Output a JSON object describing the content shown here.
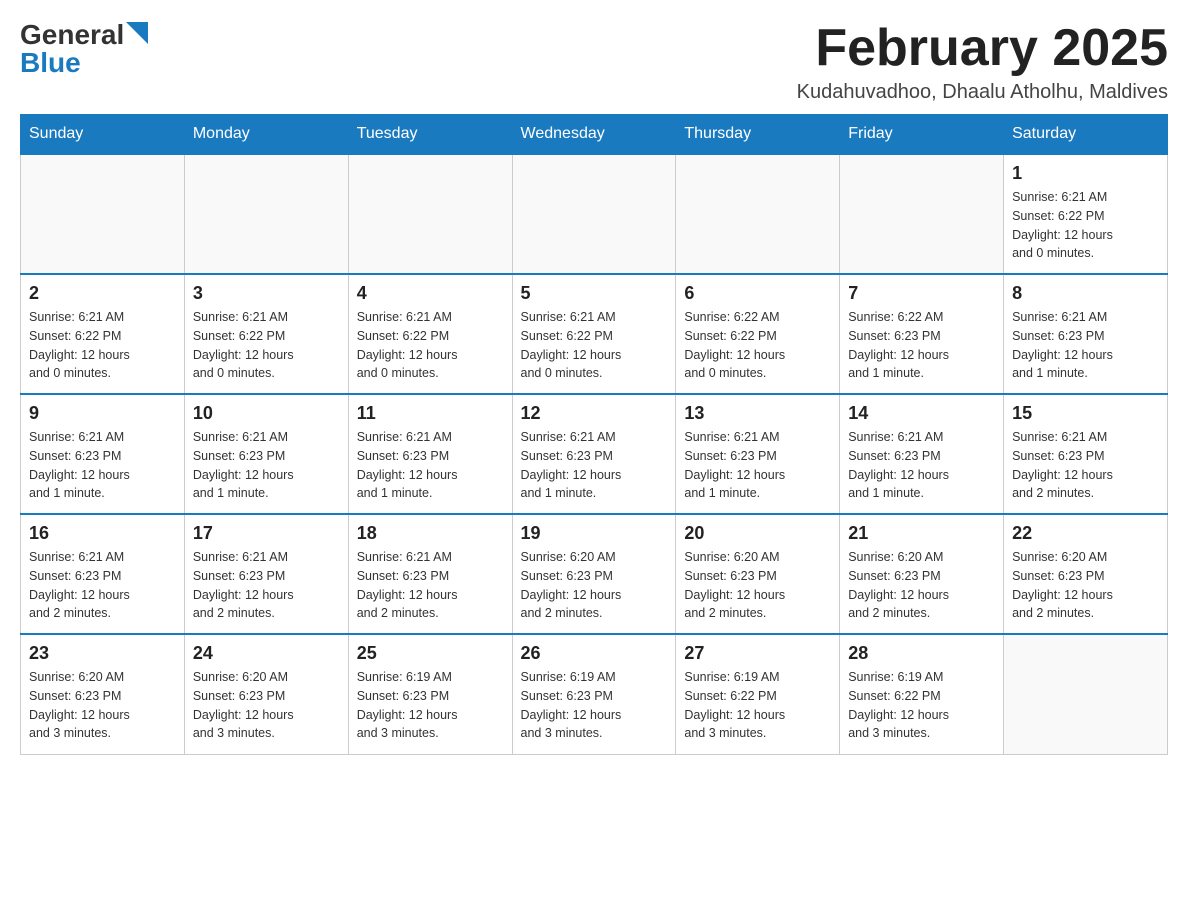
{
  "header": {
    "logo_general": "General",
    "logo_blue": "Blue",
    "month_title": "February 2025",
    "location": "Kudahuvadhoo, Dhaalu Atholhu, Maldives"
  },
  "weekdays": [
    "Sunday",
    "Monday",
    "Tuesday",
    "Wednesday",
    "Thursday",
    "Friday",
    "Saturday"
  ],
  "weeks": [
    [
      {
        "day": "",
        "info": ""
      },
      {
        "day": "",
        "info": ""
      },
      {
        "day": "",
        "info": ""
      },
      {
        "day": "",
        "info": ""
      },
      {
        "day": "",
        "info": ""
      },
      {
        "day": "",
        "info": ""
      },
      {
        "day": "1",
        "info": "Sunrise: 6:21 AM\nSunset: 6:22 PM\nDaylight: 12 hours\nand 0 minutes."
      }
    ],
    [
      {
        "day": "2",
        "info": "Sunrise: 6:21 AM\nSunset: 6:22 PM\nDaylight: 12 hours\nand 0 minutes."
      },
      {
        "day": "3",
        "info": "Sunrise: 6:21 AM\nSunset: 6:22 PM\nDaylight: 12 hours\nand 0 minutes."
      },
      {
        "day": "4",
        "info": "Sunrise: 6:21 AM\nSunset: 6:22 PM\nDaylight: 12 hours\nand 0 minutes."
      },
      {
        "day": "5",
        "info": "Sunrise: 6:21 AM\nSunset: 6:22 PM\nDaylight: 12 hours\nand 0 minutes."
      },
      {
        "day": "6",
        "info": "Sunrise: 6:22 AM\nSunset: 6:22 PM\nDaylight: 12 hours\nand 0 minutes."
      },
      {
        "day": "7",
        "info": "Sunrise: 6:22 AM\nSunset: 6:23 PM\nDaylight: 12 hours\nand 1 minute."
      },
      {
        "day": "8",
        "info": "Sunrise: 6:21 AM\nSunset: 6:23 PM\nDaylight: 12 hours\nand 1 minute."
      }
    ],
    [
      {
        "day": "9",
        "info": "Sunrise: 6:21 AM\nSunset: 6:23 PM\nDaylight: 12 hours\nand 1 minute."
      },
      {
        "day": "10",
        "info": "Sunrise: 6:21 AM\nSunset: 6:23 PM\nDaylight: 12 hours\nand 1 minute."
      },
      {
        "day": "11",
        "info": "Sunrise: 6:21 AM\nSunset: 6:23 PM\nDaylight: 12 hours\nand 1 minute."
      },
      {
        "day": "12",
        "info": "Sunrise: 6:21 AM\nSunset: 6:23 PM\nDaylight: 12 hours\nand 1 minute."
      },
      {
        "day": "13",
        "info": "Sunrise: 6:21 AM\nSunset: 6:23 PM\nDaylight: 12 hours\nand 1 minute."
      },
      {
        "day": "14",
        "info": "Sunrise: 6:21 AM\nSunset: 6:23 PM\nDaylight: 12 hours\nand 1 minute."
      },
      {
        "day": "15",
        "info": "Sunrise: 6:21 AM\nSunset: 6:23 PM\nDaylight: 12 hours\nand 2 minutes."
      }
    ],
    [
      {
        "day": "16",
        "info": "Sunrise: 6:21 AM\nSunset: 6:23 PM\nDaylight: 12 hours\nand 2 minutes."
      },
      {
        "day": "17",
        "info": "Sunrise: 6:21 AM\nSunset: 6:23 PM\nDaylight: 12 hours\nand 2 minutes."
      },
      {
        "day": "18",
        "info": "Sunrise: 6:21 AM\nSunset: 6:23 PM\nDaylight: 12 hours\nand 2 minutes."
      },
      {
        "day": "19",
        "info": "Sunrise: 6:20 AM\nSunset: 6:23 PM\nDaylight: 12 hours\nand 2 minutes."
      },
      {
        "day": "20",
        "info": "Sunrise: 6:20 AM\nSunset: 6:23 PM\nDaylight: 12 hours\nand 2 minutes."
      },
      {
        "day": "21",
        "info": "Sunrise: 6:20 AM\nSunset: 6:23 PM\nDaylight: 12 hours\nand 2 minutes."
      },
      {
        "day": "22",
        "info": "Sunrise: 6:20 AM\nSunset: 6:23 PM\nDaylight: 12 hours\nand 2 minutes."
      }
    ],
    [
      {
        "day": "23",
        "info": "Sunrise: 6:20 AM\nSunset: 6:23 PM\nDaylight: 12 hours\nand 3 minutes."
      },
      {
        "day": "24",
        "info": "Sunrise: 6:20 AM\nSunset: 6:23 PM\nDaylight: 12 hours\nand 3 minutes."
      },
      {
        "day": "25",
        "info": "Sunrise: 6:19 AM\nSunset: 6:23 PM\nDaylight: 12 hours\nand 3 minutes."
      },
      {
        "day": "26",
        "info": "Sunrise: 6:19 AM\nSunset: 6:23 PM\nDaylight: 12 hours\nand 3 minutes."
      },
      {
        "day": "27",
        "info": "Sunrise: 6:19 AM\nSunset: 6:22 PM\nDaylight: 12 hours\nand 3 minutes."
      },
      {
        "day": "28",
        "info": "Sunrise: 6:19 AM\nSunset: 6:22 PM\nDaylight: 12 hours\nand 3 minutes."
      },
      {
        "day": "",
        "info": ""
      }
    ]
  ]
}
